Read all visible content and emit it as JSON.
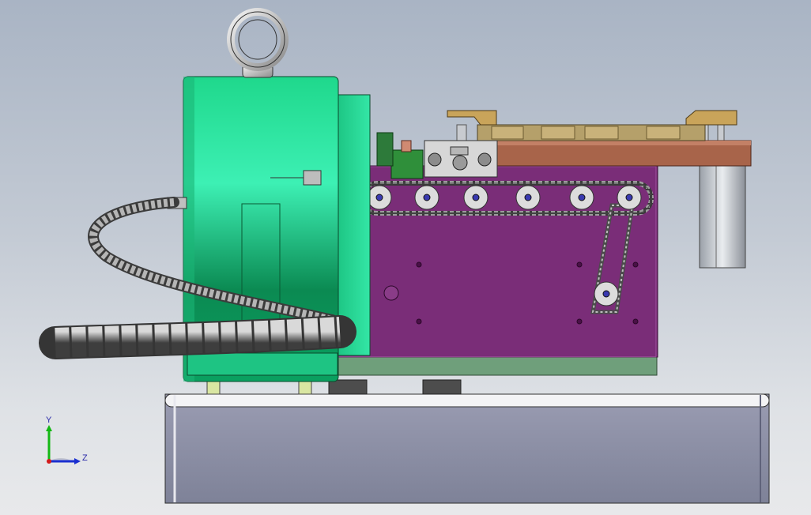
{
  "viewport": {
    "background_top": "#a9b4c4",
    "background_bottom": "#e8e9eb"
  },
  "model": {
    "colors": {
      "motor_green": "#1fd38a",
      "frame_purple": "#7a2d78",
      "base_gray": "#868aa0",
      "plate_brown": "#a8644a",
      "clamp_gold": "#c9a45a",
      "hose_gray": "#8e8e8e"
    },
    "parts": [
      "lifting-eye-bolt",
      "motor-housing",
      "drive-frame",
      "chain-sprockets",
      "feed-plate",
      "guide-clamps",
      "cable-hose",
      "base-block",
      "support-feet",
      "pneumatic-cylinder"
    ]
  },
  "triad": {
    "y_label": "Y",
    "z_label": "Z"
  }
}
